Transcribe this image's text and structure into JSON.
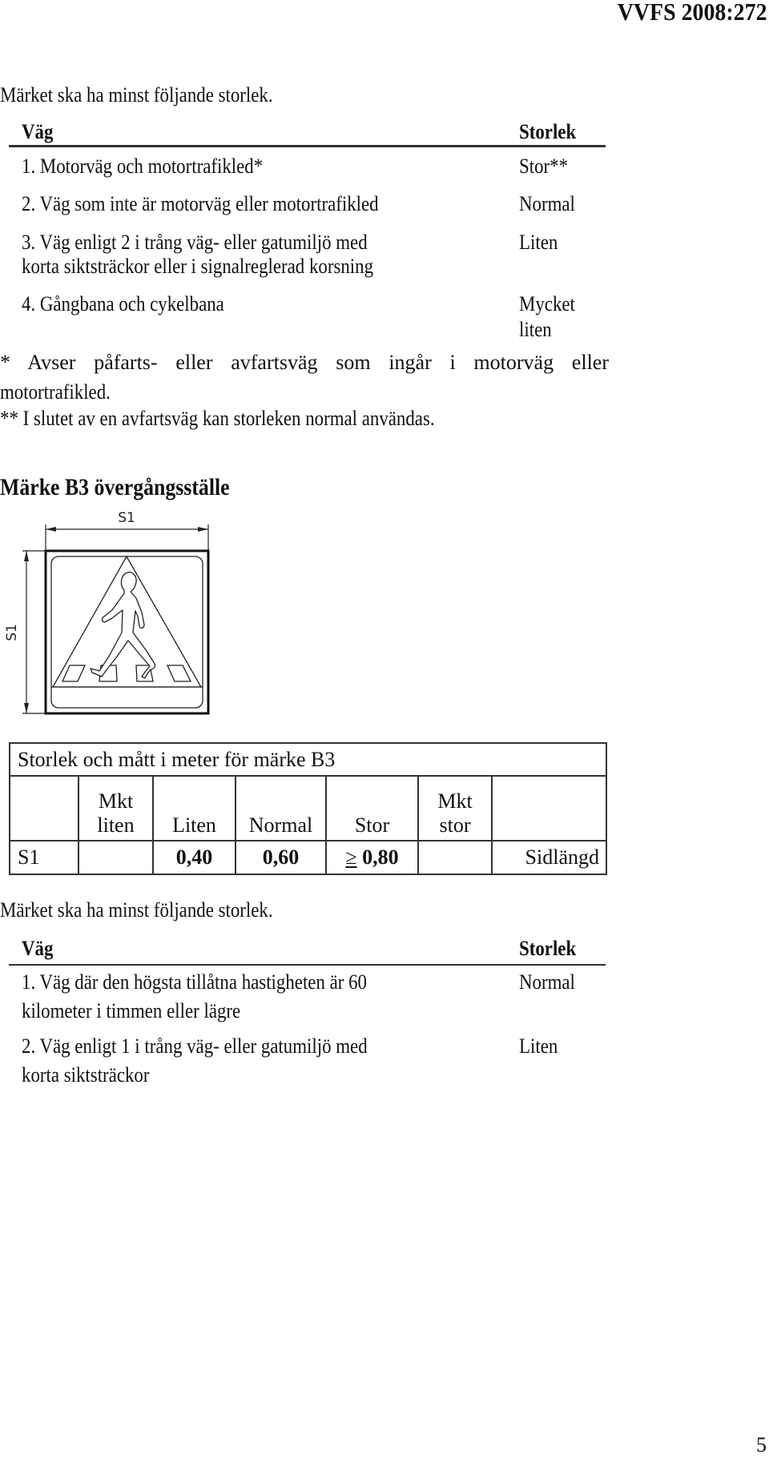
{
  "header": {
    "doc_id": "VVFS 2008:272"
  },
  "section1": {
    "intro": "Märket ska ha minst följande storlek.",
    "col_road": "Väg",
    "col_size": "Storlek",
    "rows": [
      {
        "road": "1. Motorväg och motortrafikled*",
        "size": "Stor**"
      },
      {
        "road": "2. Väg som inte är motorväg eller motortrafikled",
        "size": "Normal"
      },
      {
        "road_line1": "3. Väg enligt 2 i trång väg- eller gatumiljö med",
        "road_line2": "korta siktsträckor eller i signalreglerad korsning",
        "size": "Liten"
      },
      {
        "road": "4. Gångbana och cykelbana",
        "size_line1": "Mycket",
        "size_line2": "liten"
      }
    ],
    "footnote1_line1": "* Avser påfarts- eller avfartsväg som ingår i motorväg eller",
    "footnote1_line2": "motortrafikled.",
    "footnote2": "** I slutet av en avfartsväg kan storleken normal användas."
  },
  "sign_section": {
    "heading": "Märke B3 övergångsställe",
    "dimension_label_horizontal": "S1",
    "dimension_label_vertical": "S1",
    "sign_icon": "pedestrian-crossing-sign"
  },
  "size_table": {
    "title": "Storlek och mått i meter för märke B3",
    "columns": [
      {
        "line1": "",
        "line2": ""
      },
      {
        "line1": "Mkt",
        "line2": "liten"
      },
      {
        "line1": "",
        "line2": "Liten"
      },
      {
        "line1": "",
        "line2": "Normal"
      },
      {
        "line1": "",
        "line2": "Stor"
      },
      {
        "line1": "Mkt",
        "line2": "stor"
      },
      {
        "line1": "",
        "line2": ""
      }
    ],
    "rows": [
      {
        "label": "S1",
        "mkt_liten": "",
        "liten": "0,40",
        "normal": "0,60",
        "stor_prefix": "≥",
        "stor": "0,80",
        "mkt_stor": "",
        "note": "Sidlängd"
      }
    ]
  },
  "section2": {
    "intro": "Märket ska ha minst följande storlek.",
    "col_road": "Väg",
    "col_size": "Storlek",
    "rows": [
      {
        "road_line1": "1. Väg där den högsta tillåtna hastigheten är 60",
        "road_line2": "kilometer i timmen eller lägre",
        "size": "Normal"
      },
      {
        "road_line1": "2. Väg enligt 1 i trång väg- eller gatumiljö med",
        "road_line2": "korta siktsträckor",
        "size": "Liten"
      }
    ]
  },
  "footer": {
    "page_number": "5"
  }
}
